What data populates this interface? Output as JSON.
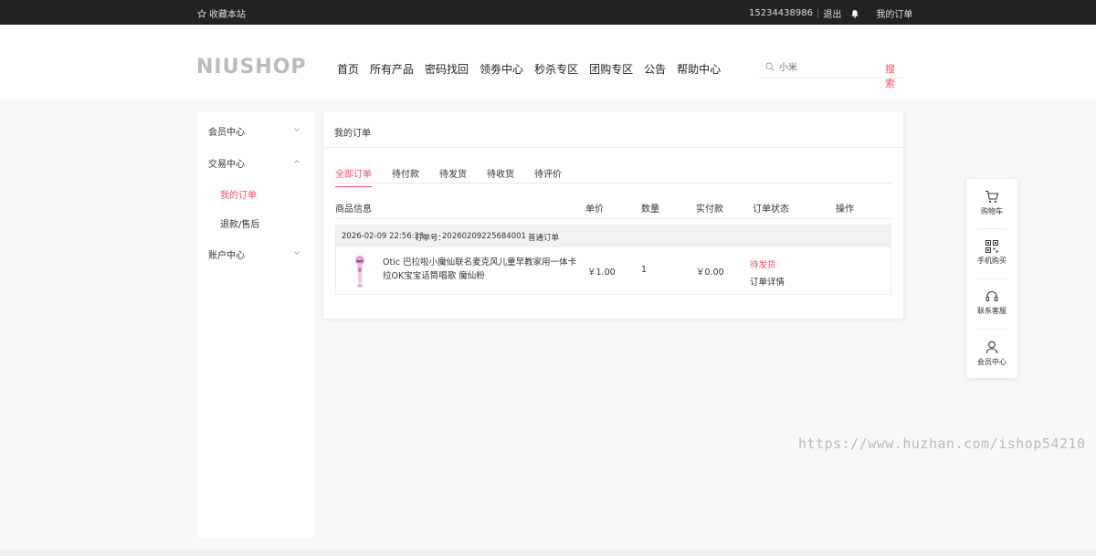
{
  "topbar": {
    "favorite_label": "收藏本站",
    "phone": "15234438986",
    "logout_label": "退出",
    "my_orders_label": "我的订单"
  },
  "header": {
    "logo_text": "NIUSHOP",
    "nav": [
      "首页",
      "所有产品",
      "密码找回",
      "领劵中心",
      "秒杀专区",
      "团购专区",
      "公告",
      "帮助中心"
    ],
    "search": {
      "value": "小米",
      "button_label": "搜索"
    }
  },
  "sidebar": {
    "member_center": "会员中心",
    "trade_center": "交易中心",
    "my_orders": "我的订单",
    "refunds": "退款/售后",
    "account_center": "账户中心"
  },
  "panel": {
    "title": "我的订单",
    "tabs": [
      "全部订单",
      "待付款",
      "待发货",
      "待收货",
      "待评价"
    ],
    "active_tab": "全部订单",
    "columns": {
      "product_info": "商品信息",
      "unit_price": "单价",
      "quantity": "数量",
      "paid": "实付款",
      "order_status": "订单状态",
      "actions": "操作"
    },
    "order": {
      "datetime": "2026-02-09 22:56:33",
      "order_no_label": "订单号：",
      "order_no": "20260209225684001",
      "order_type": "普通订单",
      "product_name": "Otic 巴拉啦小魔仙联名麦克风儿童早教家用一体卡拉OK宝宝话筒唱歌 魔仙粉",
      "unit_price": "￥1.00",
      "quantity": "1",
      "paid": "￥0.00",
      "status": "待发货",
      "detail_label": "订单详情"
    }
  },
  "float_toolbar": {
    "items": [
      {
        "label": "购物车",
        "icon": "cart-icon"
      },
      {
        "label": "手机购买",
        "icon": "qr-code-icon"
      },
      {
        "label": "联系客服",
        "icon": "headset-icon"
      },
      {
        "label": "会员中心",
        "icon": "user-icon"
      }
    ]
  },
  "watermark": "https://www.huzhan.com/ishop54210",
  "colors": {
    "accent": "#f5506e",
    "topbar_bg": "#222222"
  }
}
